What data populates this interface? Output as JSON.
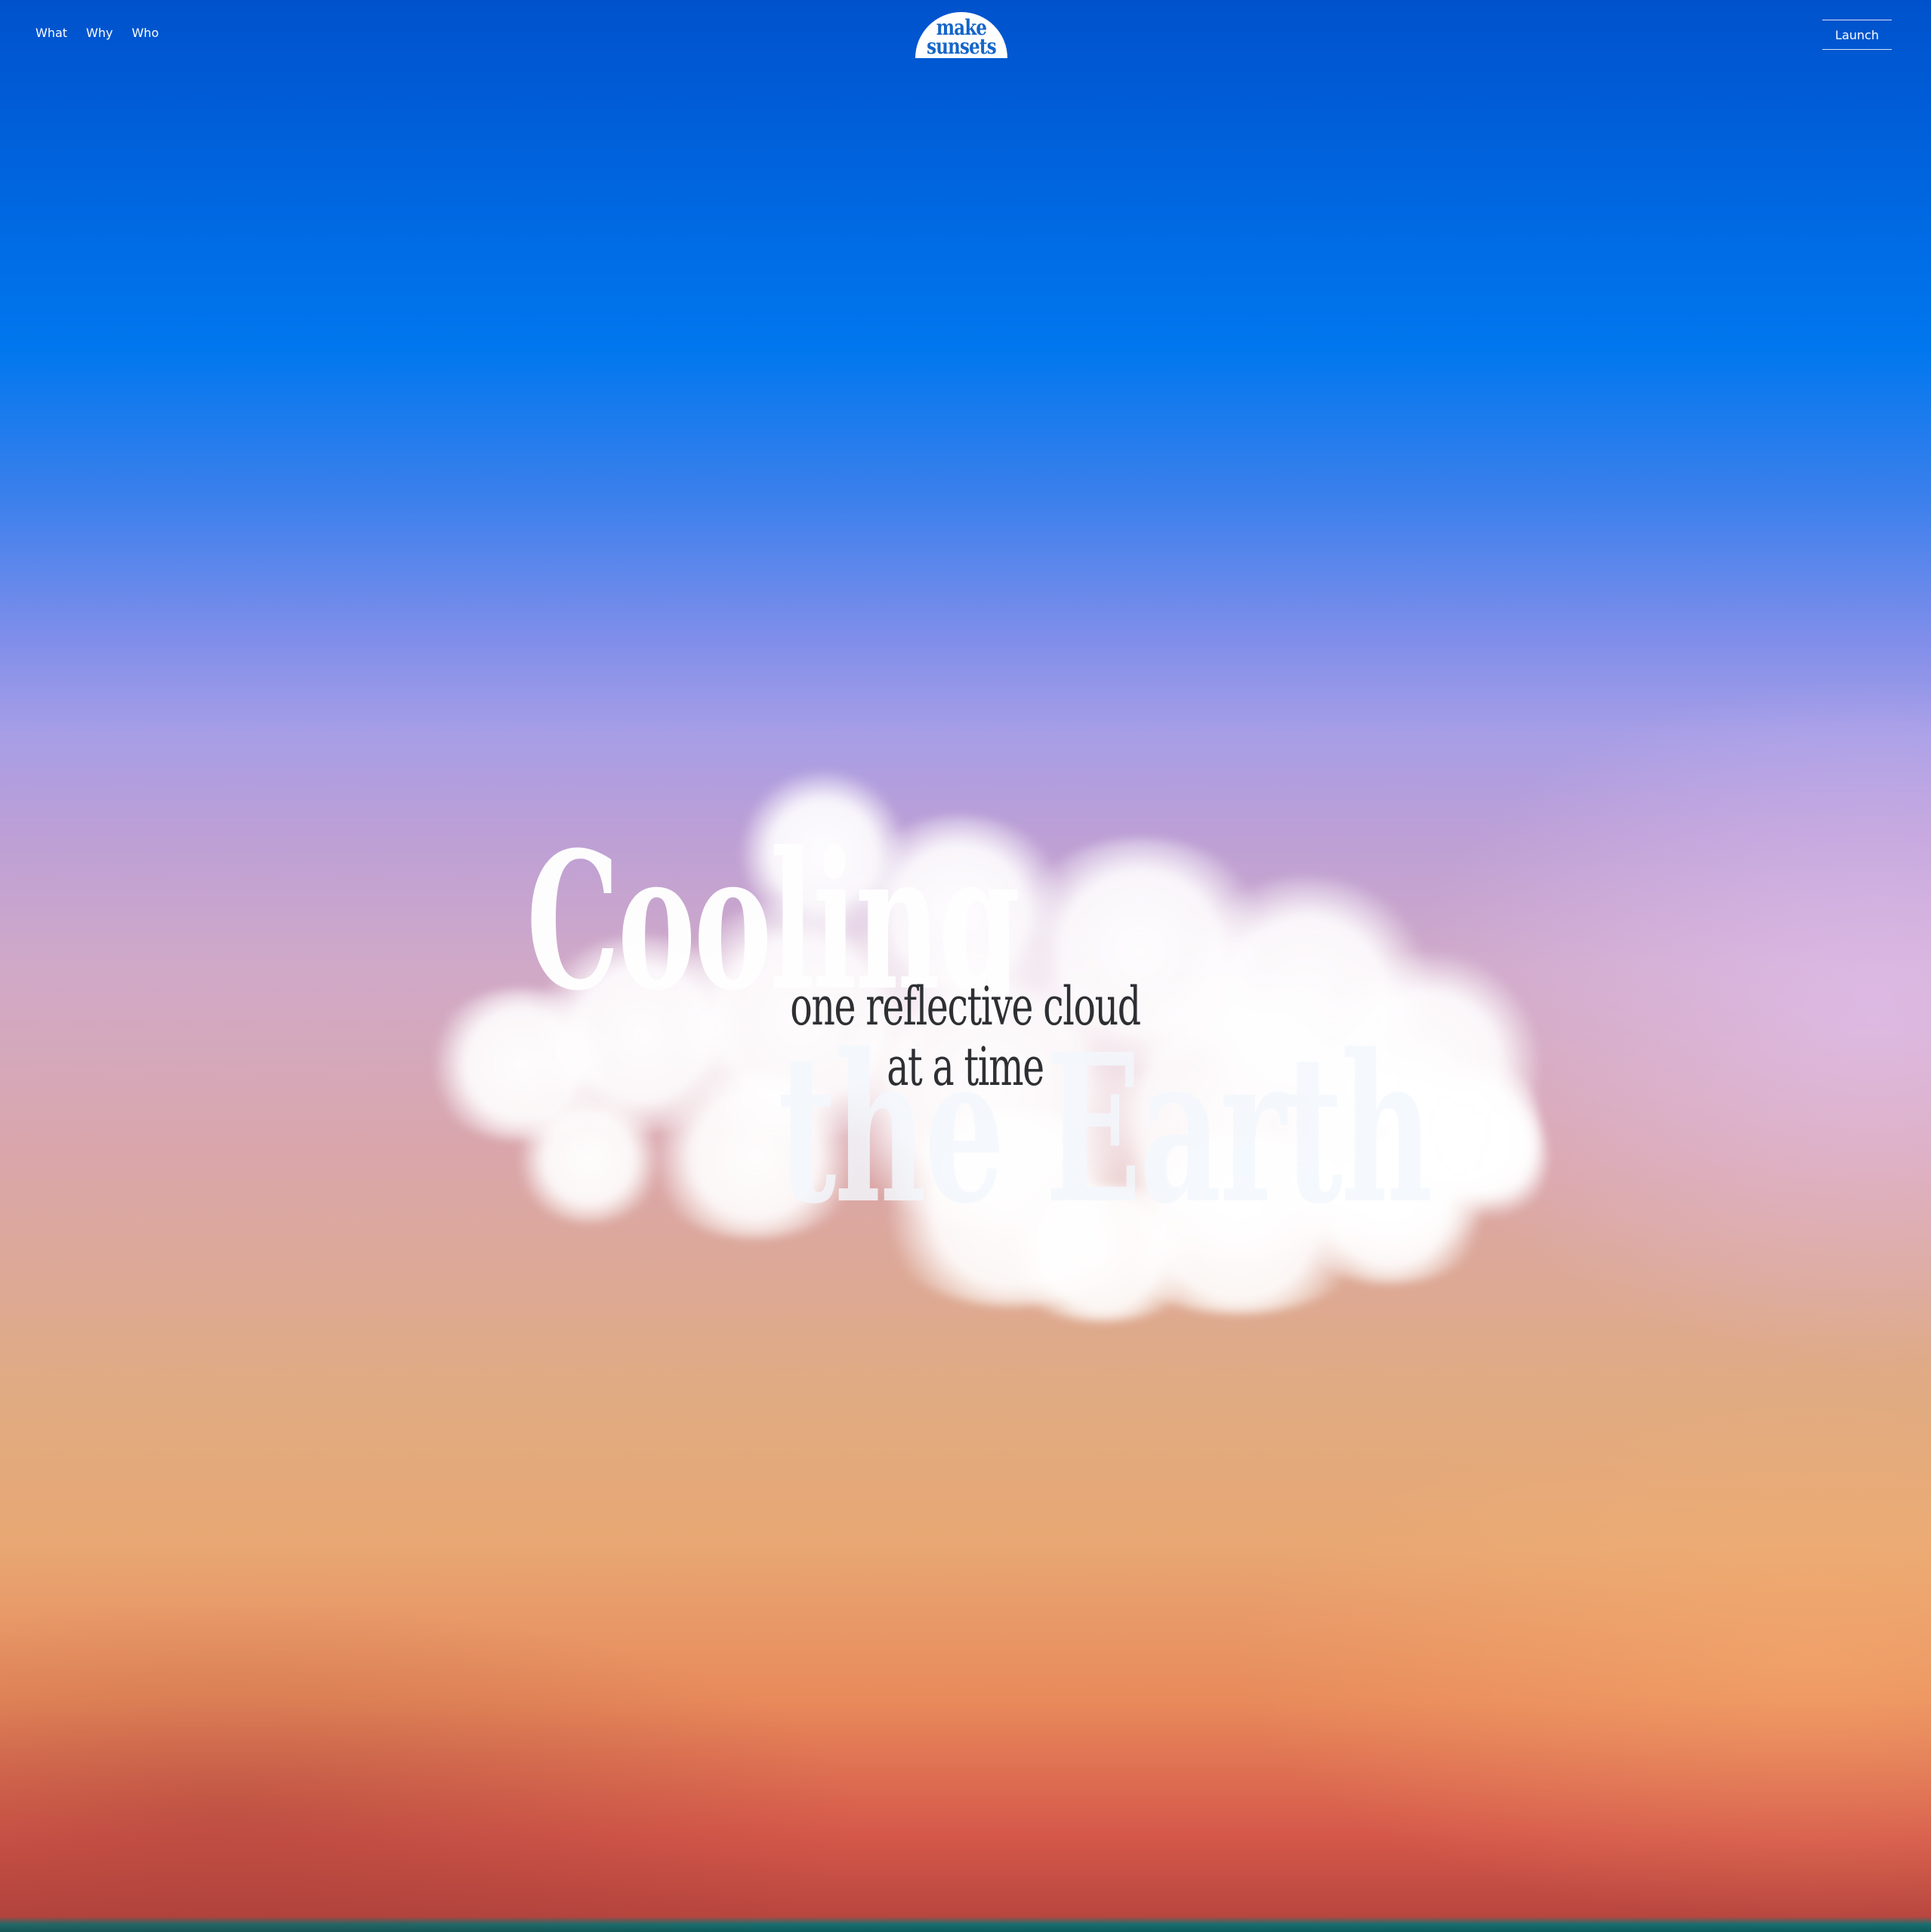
{
  "nav": {
    "items": [
      {
        "label": "What"
      },
      {
        "label": "Why"
      },
      {
        "label": "Who"
      }
    ]
  },
  "logo": {
    "line1": "make",
    "line2": "sunsets"
  },
  "launch": {
    "label": "Launch"
  },
  "hero": {
    "headline_line1": "Cooling",
    "headline_line2": "the Earth",
    "tagline_line1": "one reflective cloud",
    "tagline_line2": "at a time"
  },
  "colors": {
    "sky_top": "#0052cc",
    "sky_mid": "#a79ee6",
    "sky_low": "#e0ab82",
    "horizon": "#d5584a",
    "logo_text": "#1565c9",
    "tagline_text": "#2e2f33"
  }
}
